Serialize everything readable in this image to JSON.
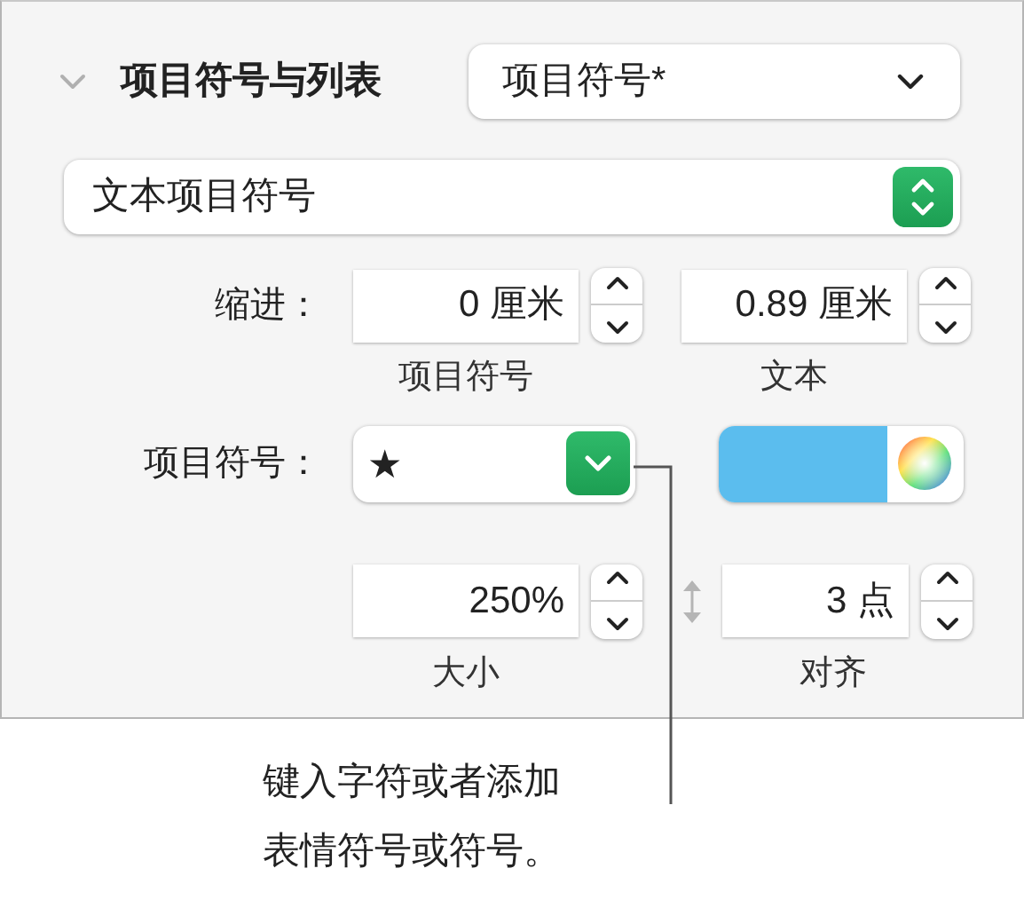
{
  "section": {
    "title": "项目符号与列表",
    "expanded": true,
    "style_popup": {
      "value": "项目符号*"
    }
  },
  "bullet_type": {
    "value": "文本项目符号"
  },
  "indent": {
    "label": "缩进：",
    "fields": [
      {
        "value": "0 厘米",
        "caption": "项目符号"
      },
      {
        "value": "0.89 厘米",
        "caption": "文本"
      }
    ]
  },
  "bullet": {
    "label": "项目符号：",
    "value": "★",
    "color": "#5bbdee"
  },
  "size_align": {
    "fields": [
      {
        "value": "250%",
        "caption": "大小"
      },
      {
        "value": "3 点",
        "caption": "对齐"
      }
    ]
  },
  "callout": {
    "lines": [
      "键入字符或者添加",
      "表情符号或符号。"
    ]
  }
}
